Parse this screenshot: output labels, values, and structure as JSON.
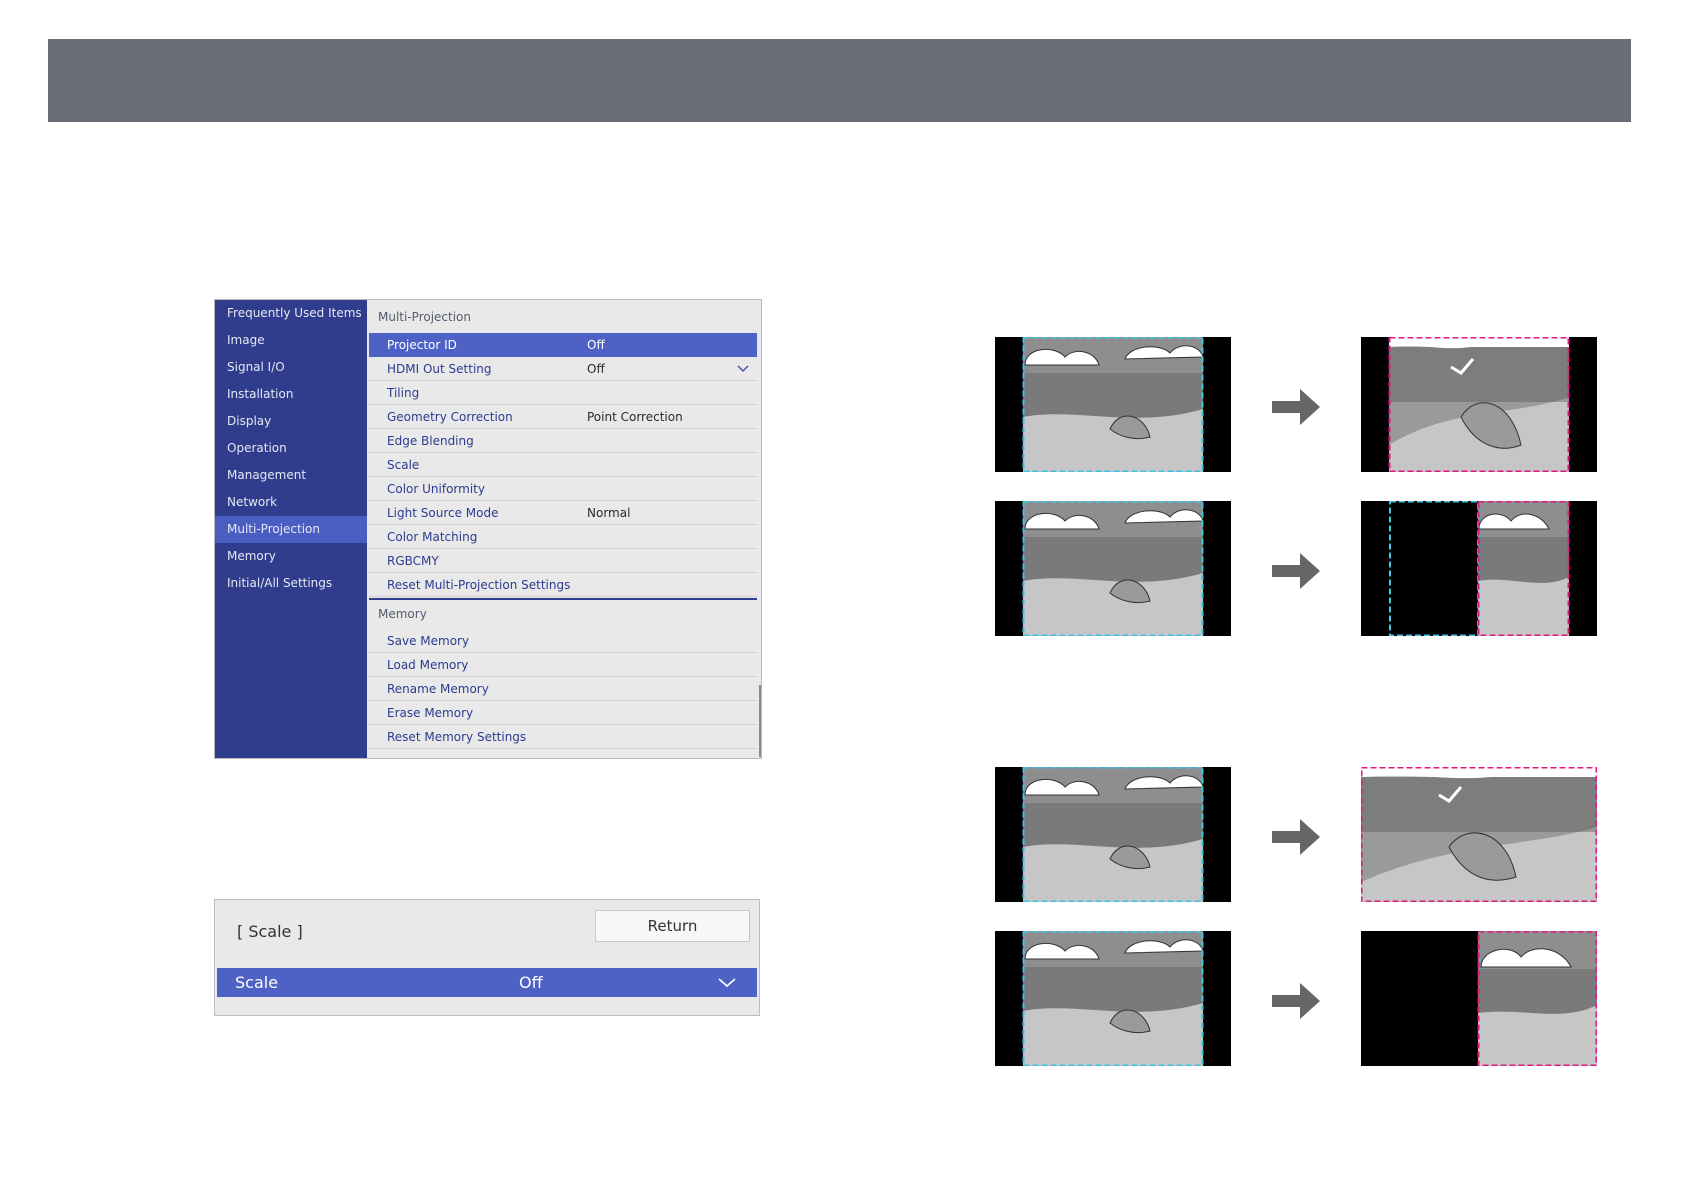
{
  "menu": {
    "sidebar": [
      {
        "label": "Frequently Used Items"
      },
      {
        "label": "Image"
      },
      {
        "label": "Signal I/O"
      },
      {
        "label": "Installation"
      },
      {
        "label": "Display"
      },
      {
        "label": "Operation"
      },
      {
        "label": "Management"
      },
      {
        "label": "Network"
      },
      {
        "label": "Multi-Projection",
        "active": true
      },
      {
        "label": "Memory"
      },
      {
        "label": "Initial/All Settings"
      }
    ],
    "multi_projection_header": "Multi-Projection",
    "multi_projection_items": [
      {
        "label": "Projector ID",
        "value": "Off"
      },
      {
        "label": "HDMI Out Setting",
        "value": "Off"
      },
      {
        "label": "Tiling",
        "value": ""
      },
      {
        "label": "Geometry Correction",
        "value": "Point Correction"
      },
      {
        "label": "Edge Blending",
        "value": ""
      },
      {
        "label": "Scale",
        "value": ""
      },
      {
        "label": "Color Uniformity",
        "value": ""
      },
      {
        "label": "Light Source Mode",
        "value": "Normal"
      },
      {
        "label": "Color Matching",
        "value": ""
      },
      {
        "label": "RGBCMY",
        "value": ""
      },
      {
        "label": "Reset Multi-Projection Settings",
        "value": ""
      }
    ],
    "memory_header": "Memory",
    "memory_items": [
      {
        "label": "Save Memory"
      },
      {
        "label": "Load Memory"
      },
      {
        "label": "Rename Memory"
      },
      {
        "label": "Erase Memory"
      },
      {
        "label": "Reset Memory Settings"
      }
    ]
  },
  "scale_dialog": {
    "title": "[ Scale ]",
    "return_label": "Return",
    "row_label": "Scale",
    "row_value": "Off"
  },
  "colors": {
    "sidebar_bg": "#2f3d8c",
    "selected_bg": "#4d62c4",
    "source_frame": "#3ec3e0",
    "result_frame": "#e0197d",
    "arrow": "#666666"
  }
}
